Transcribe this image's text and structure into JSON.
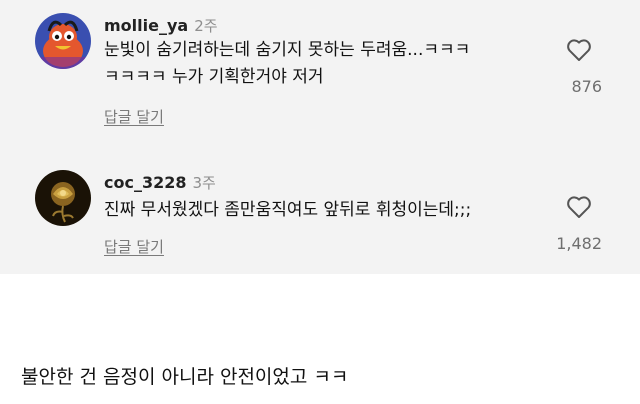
{
  "comments": [
    {
      "username": "mollie_ya",
      "time": "2주",
      "text": "눈빛이 숨기려하는데 숨기지 못하는 두려움...ㅋㅋㅋ\nㅋㅋㅋㅋ 누가 기획한거야 저거",
      "reply_label": "답글 달기",
      "likes": "876",
      "avatar_icon": "cartoon-character-avatar",
      "avatar_colors": [
        "#e4572e",
        "#3a4fb0"
      ]
    },
    {
      "username": "coc_3228",
      "time": "3주",
      "text": "진짜 무서웠겠다 좀만움직여도 앞뒤로 휘청이는데;;;",
      "reply_label": "답글 달기",
      "likes": "1,482",
      "avatar_icon": "golden-rose-avatar",
      "avatar_colors": [
        "#1a1206",
        "#c9a040"
      ]
    }
  ],
  "caption": "불안한 건 음정이 아니라 안전이었고 ㅋㅋ"
}
